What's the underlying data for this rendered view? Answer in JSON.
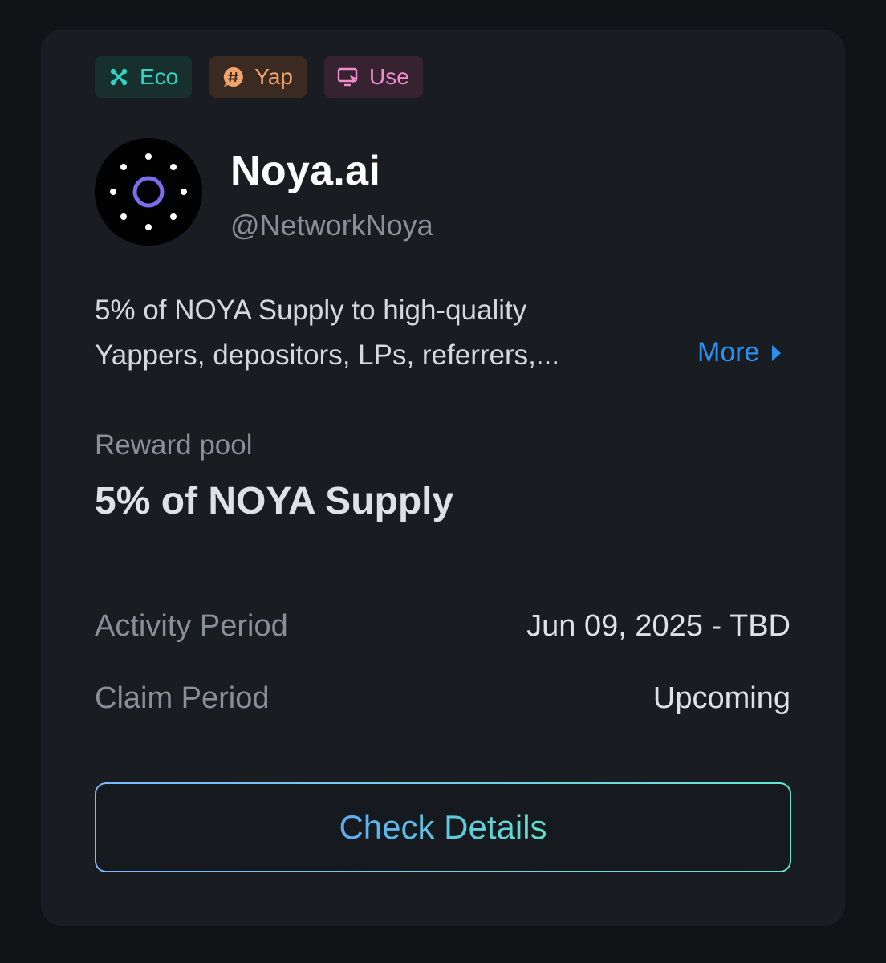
{
  "tags": [
    {
      "label": "Eco",
      "icon": "cross-icon",
      "color": "#2fd6c4"
    },
    {
      "label": "Yap",
      "icon": "hashtag-icon",
      "color": "#f0a36a"
    },
    {
      "label": "Use",
      "icon": "monitor-cursor-icon",
      "color": "#f08bd0"
    }
  ],
  "project": {
    "name": "Noya.ai",
    "handle": "@NetworkNoya",
    "description_line1": "5% of NOYA Supply to high-quality",
    "description_line2": "Yappers, depositors, LPs, referrers,...",
    "more_label": "More"
  },
  "reward": {
    "label": "Reward pool",
    "value": "5% of NOYA Supply"
  },
  "details": {
    "activity_label": "Activity Period",
    "activity_value": "Jun 09, 2025 - TBD",
    "claim_label": "Claim Period",
    "claim_value": "Upcoming"
  },
  "cta": {
    "label": "Check Details"
  },
  "colors": {
    "background": "#111317",
    "card": "#191c21",
    "link": "#2b8ff0",
    "button_gradient_start": "#7fb7ff",
    "button_gradient_end": "#62e6d3"
  }
}
